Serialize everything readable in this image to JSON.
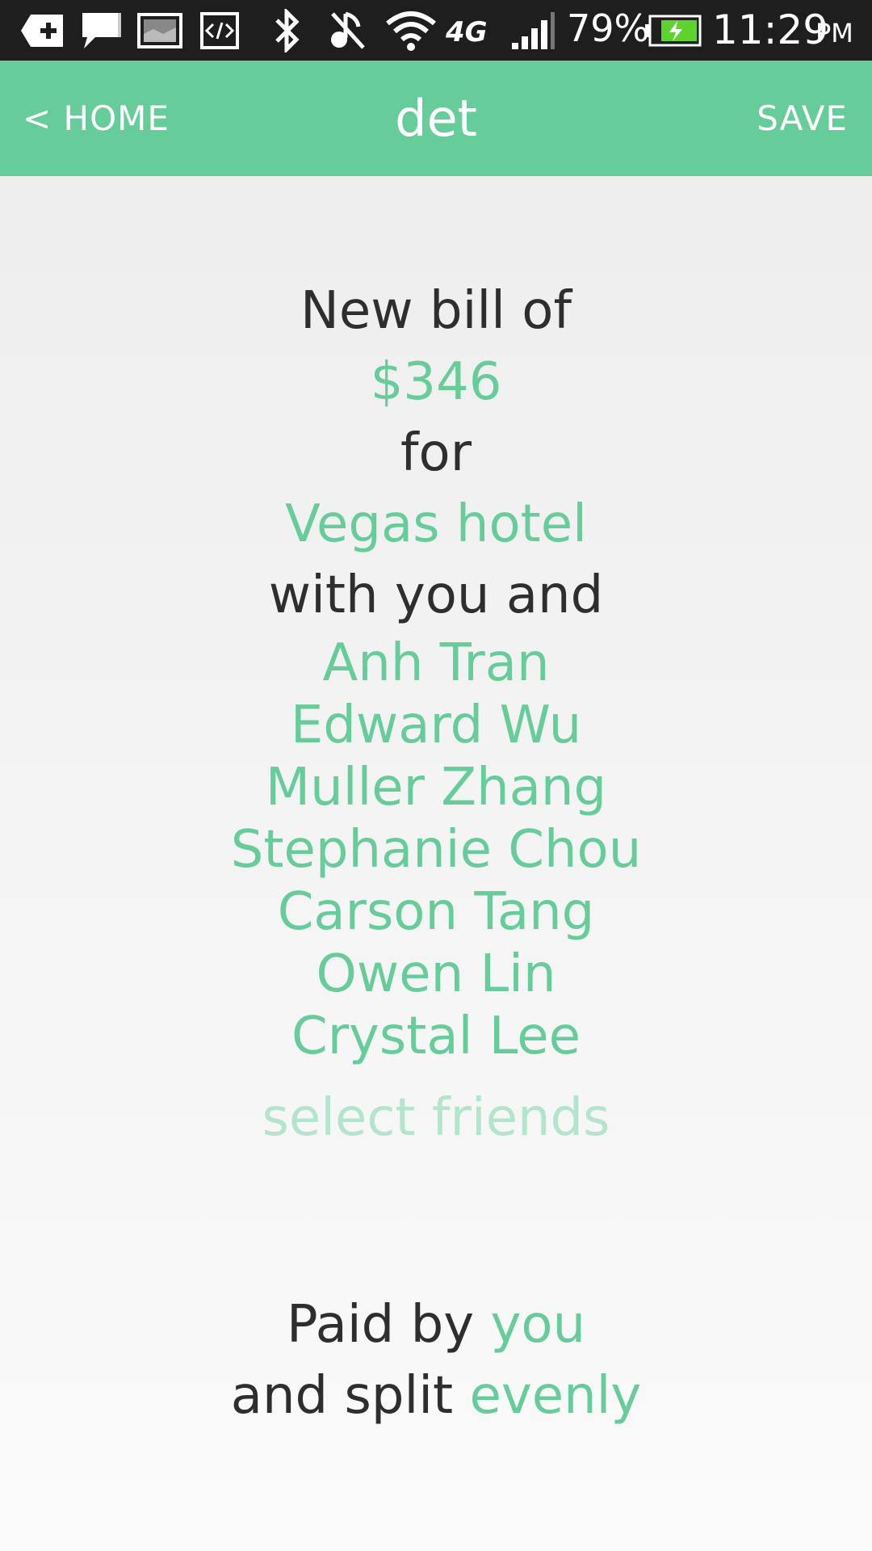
{
  "status_bar": {
    "battery": "79%",
    "time": "11:29",
    "ampm": "PM",
    "network": "4G",
    "icons": [
      "add-notification-icon",
      "message-icon",
      "image-icon",
      "code-icon",
      "bluetooth-icon",
      "mute-icon",
      "wifi-icon",
      "4g-icon",
      "signal-icon",
      "battery-charging-icon"
    ]
  },
  "app_bar": {
    "back_label": "< HOME",
    "title": "det",
    "save_label": "SAVE",
    "color": "#66cc99"
  },
  "bill": {
    "intro": "New bill of",
    "amount": "$346",
    "for_label": "for",
    "description": "Vegas hotel",
    "with_label": "with you and",
    "friends": [
      "Anh Tran",
      "Edward Wu",
      "Muller Zhang",
      "Stephanie Chou",
      "Carson Tang",
      "Owen Lin",
      "Crystal Lee"
    ],
    "select_friends": "select friends",
    "paid_by_label": "Paid by",
    "paid_by_value": "you",
    "split_label": "and split",
    "split_value": "evenly"
  },
  "colors": {
    "accent": "#66cc99",
    "accent_light": "#b2e5cc",
    "text": "#2e2e2e"
  }
}
